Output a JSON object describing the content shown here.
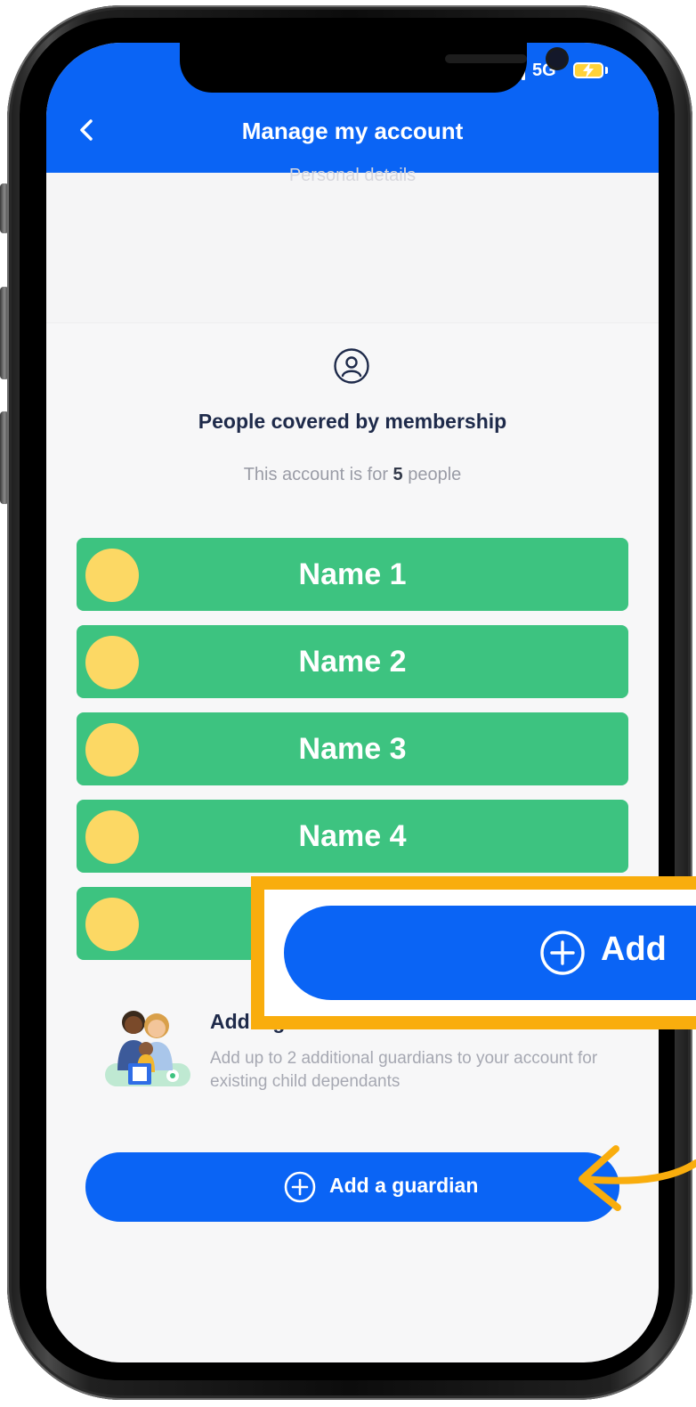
{
  "header": {
    "title": "Manage my account",
    "network": "5G"
  },
  "top_section": {
    "faded_text": "Personal details"
  },
  "membership": {
    "title": "People covered by membership",
    "subtitle_prefix": "This account is for ",
    "count": "5",
    "subtitle_suffix": " people",
    "members": [
      {
        "name": "Name 1"
      },
      {
        "name": "Name 2"
      },
      {
        "name": "Name 3"
      },
      {
        "name": "Name 4"
      },
      {
        "name": ""
      }
    ]
  },
  "guardian": {
    "title": "Add a guardian",
    "description": "Add up to 2 additional guardians to your account for existing child dependants",
    "button_label": "Add a guardian"
  },
  "callout": {
    "label": "Add"
  },
  "colors": {
    "brand_blue": "#0a64f5",
    "member_green": "#3dc380",
    "avatar_yellow": "#fcd864",
    "callout_orange": "#f9ad0d"
  },
  "icons": {
    "back": "chevron-left-icon",
    "user": "user-circle-icon",
    "plus": "plus-circle-icon",
    "arrow": "curved-arrow-icon"
  }
}
